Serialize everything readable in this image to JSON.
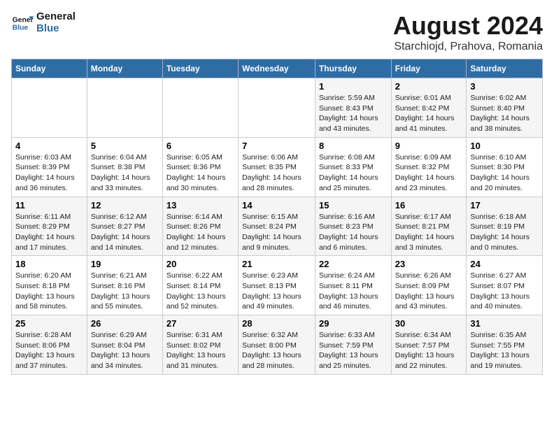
{
  "logo": {
    "line1": "General",
    "line2": "Blue"
  },
  "title": "August 2024",
  "subtitle": "Starchiojd, Prahova, Romania",
  "headers": [
    "Sunday",
    "Monday",
    "Tuesday",
    "Wednesday",
    "Thursday",
    "Friday",
    "Saturday"
  ],
  "weeks": [
    [
      {
        "day": "",
        "info": ""
      },
      {
        "day": "",
        "info": ""
      },
      {
        "day": "",
        "info": ""
      },
      {
        "day": "",
        "info": ""
      },
      {
        "day": "1",
        "info": "Sunrise: 5:59 AM\nSunset: 8:43 PM\nDaylight: 14 hours and 43 minutes."
      },
      {
        "day": "2",
        "info": "Sunrise: 6:01 AM\nSunset: 8:42 PM\nDaylight: 14 hours and 41 minutes."
      },
      {
        "day": "3",
        "info": "Sunrise: 6:02 AM\nSunset: 8:40 PM\nDaylight: 14 hours and 38 minutes."
      }
    ],
    [
      {
        "day": "4",
        "info": "Sunrise: 6:03 AM\nSunset: 8:39 PM\nDaylight: 14 hours and 36 minutes."
      },
      {
        "day": "5",
        "info": "Sunrise: 6:04 AM\nSunset: 8:38 PM\nDaylight: 14 hours and 33 minutes."
      },
      {
        "day": "6",
        "info": "Sunrise: 6:05 AM\nSunset: 8:36 PM\nDaylight: 14 hours and 30 minutes."
      },
      {
        "day": "7",
        "info": "Sunrise: 6:06 AM\nSunset: 8:35 PM\nDaylight: 14 hours and 28 minutes."
      },
      {
        "day": "8",
        "info": "Sunrise: 6:08 AM\nSunset: 8:33 PM\nDaylight: 14 hours and 25 minutes."
      },
      {
        "day": "9",
        "info": "Sunrise: 6:09 AM\nSunset: 8:32 PM\nDaylight: 14 hours and 23 minutes."
      },
      {
        "day": "10",
        "info": "Sunrise: 6:10 AM\nSunset: 8:30 PM\nDaylight: 14 hours and 20 minutes."
      }
    ],
    [
      {
        "day": "11",
        "info": "Sunrise: 6:11 AM\nSunset: 8:29 PM\nDaylight: 14 hours and 17 minutes."
      },
      {
        "day": "12",
        "info": "Sunrise: 6:12 AM\nSunset: 8:27 PM\nDaylight: 14 hours and 14 minutes."
      },
      {
        "day": "13",
        "info": "Sunrise: 6:14 AM\nSunset: 8:26 PM\nDaylight: 14 hours and 12 minutes."
      },
      {
        "day": "14",
        "info": "Sunrise: 6:15 AM\nSunset: 8:24 PM\nDaylight: 14 hours and 9 minutes."
      },
      {
        "day": "15",
        "info": "Sunrise: 6:16 AM\nSunset: 8:23 PM\nDaylight: 14 hours and 6 minutes."
      },
      {
        "day": "16",
        "info": "Sunrise: 6:17 AM\nSunset: 8:21 PM\nDaylight: 14 hours and 3 minutes."
      },
      {
        "day": "17",
        "info": "Sunrise: 6:18 AM\nSunset: 8:19 PM\nDaylight: 14 hours and 0 minutes."
      }
    ],
    [
      {
        "day": "18",
        "info": "Sunrise: 6:20 AM\nSunset: 8:18 PM\nDaylight: 13 hours and 58 minutes."
      },
      {
        "day": "19",
        "info": "Sunrise: 6:21 AM\nSunset: 8:16 PM\nDaylight: 13 hours and 55 minutes."
      },
      {
        "day": "20",
        "info": "Sunrise: 6:22 AM\nSunset: 8:14 PM\nDaylight: 13 hours and 52 minutes."
      },
      {
        "day": "21",
        "info": "Sunrise: 6:23 AM\nSunset: 8:13 PM\nDaylight: 13 hours and 49 minutes."
      },
      {
        "day": "22",
        "info": "Sunrise: 6:24 AM\nSunset: 8:11 PM\nDaylight: 13 hours and 46 minutes."
      },
      {
        "day": "23",
        "info": "Sunrise: 6:26 AM\nSunset: 8:09 PM\nDaylight: 13 hours and 43 minutes."
      },
      {
        "day": "24",
        "info": "Sunrise: 6:27 AM\nSunset: 8:07 PM\nDaylight: 13 hours and 40 minutes."
      }
    ],
    [
      {
        "day": "25",
        "info": "Sunrise: 6:28 AM\nSunset: 8:06 PM\nDaylight: 13 hours and 37 minutes."
      },
      {
        "day": "26",
        "info": "Sunrise: 6:29 AM\nSunset: 8:04 PM\nDaylight: 13 hours and 34 minutes."
      },
      {
        "day": "27",
        "info": "Sunrise: 6:31 AM\nSunset: 8:02 PM\nDaylight: 13 hours and 31 minutes."
      },
      {
        "day": "28",
        "info": "Sunrise: 6:32 AM\nSunset: 8:00 PM\nDaylight: 13 hours and 28 minutes."
      },
      {
        "day": "29",
        "info": "Sunrise: 6:33 AM\nSunset: 7:59 PM\nDaylight: 13 hours and 25 minutes."
      },
      {
        "day": "30",
        "info": "Sunrise: 6:34 AM\nSunset: 7:57 PM\nDaylight: 13 hours and 22 minutes."
      },
      {
        "day": "31",
        "info": "Sunrise: 6:35 AM\nSunset: 7:55 PM\nDaylight: 13 hours and 19 minutes."
      }
    ]
  ]
}
